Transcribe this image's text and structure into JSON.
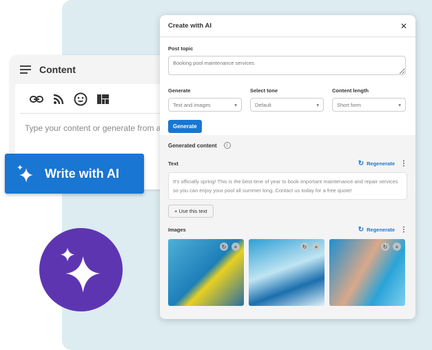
{
  "content_card": {
    "title": "Content",
    "placeholder": "Type your content or generate from a prompt",
    "tools": [
      "link-icon",
      "rss-icon",
      "emoji-icon",
      "layout-icon"
    ]
  },
  "write_ai": {
    "label": "Write with AI"
  },
  "dialog": {
    "title": "Create with AI",
    "post_topic": {
      "label": "Post topic",
      "value": "Booking pool maintenance services"
    },
    "generate": {
      "label": "Generate",
      "value": "Text and images"
    },
    "tone": {
      "label": "Select tone",
      "value": "Default"
    },
    "length": {
      "label": "Content length",
      "value": "Short form"
    },
    "generate_button": "Generate",
    "generated": {
      "title": "Generated content",
      "text_label": "Text",
      "regenerate": "Regenerate",
      "text": "It's officially spring! This is the best time of year to book important maintenance and repair services so you can enjoy your pool all summer long. Contact us today for a free quote!",
      "use_text": "Use this text",
      "images_label": "Images"
    }
  },
  "colors": {
    "accent": "#1976d2",
    "purple": "#5e35b1",
    "background": "#dcecf1"
  }
}
